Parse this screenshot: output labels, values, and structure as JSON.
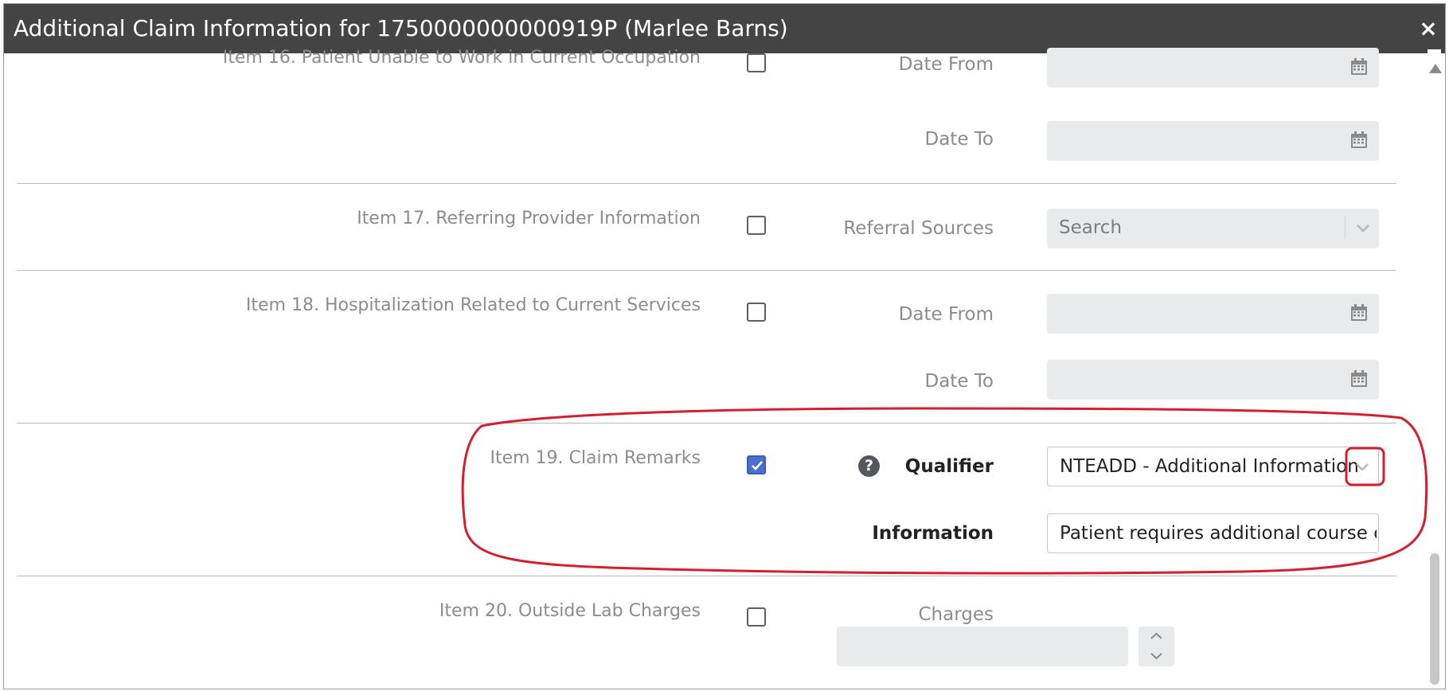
{
  "dialog": {
    "title": "Additional Claim Information for 1750000000000919P (Marlee Barns)",
    "close_label": "×"
  },
  "items": {
    "item16": {
      "label": "Item 16. Patient Unable to Work in Current Occupation",
      "checked": false,
      "date_from_label": "Date From",
      "date_to_label": "Date To"
    },
    "item17": {
      "label": "Item 17. Referring Provider Information",
      "checked": false,
      "referral_label": "Referral Sources",
      "referral_placeholder": "Search"
    },
    "item18": {
      "label": "Item 18. Hospitalization Related to Current Services",
      "checked": false,
      "date_from_label": "Date From",
      "date_to_label": "Date To"
    },
    "item19": {
      "label": "Item 19. Claim Remarks",
      "checked": true,
      "help_label": "?",
      "qualifier_label": "Qualifier",
      "qualifier_value": "NTEADD - Additional Information",
      "information_label": "Information",
      "information_value": "Patient requires additional course of treatment"
    },
    "item20": {
      "label": "Item 20. Outside Lab Charges",
      "checked": false,
      "charges_label": "Charges"
    }
  },
  "icons": {
    "calendar": "calendar-icon",
    "chevron": "chevron-down-icon",
    "check": "check-icon",
    "help": "question-circle-icon"
  },
  "colors": {
    "titlebar": "#444444",
    "checkbox_checked": "#4b6fd1",
    "annotation": "#d32030"
  }
}
